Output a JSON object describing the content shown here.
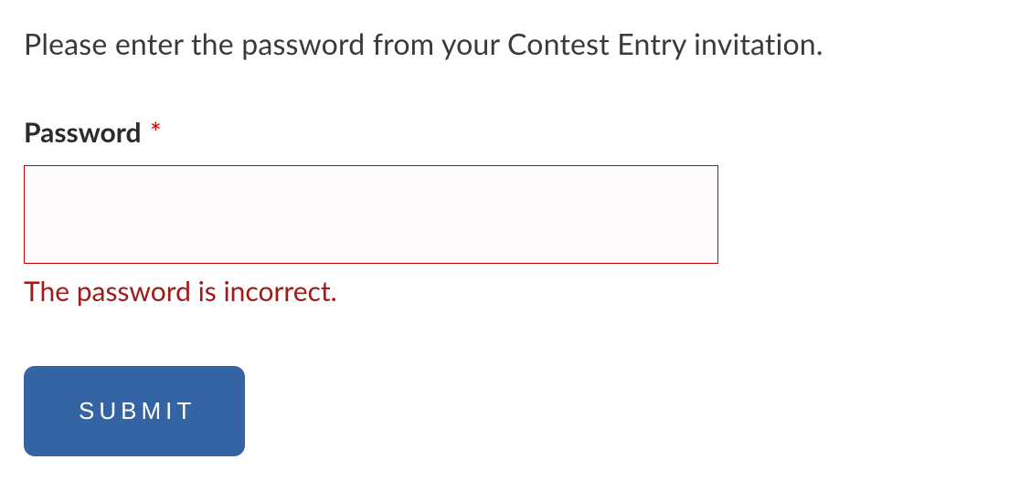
{
  "instruction": "Please enter the password from your Contest Entry invitation.",
  "field": {
    "label": "Password",
    "required_marker": "*",
    "value": "",
    "error": "The password is incorrect."
  },
  "submit_label": "SUBMIT",
  "colors": {
    "error_border": "#c70000",
    "error_text": "#a01a1a",
    "button_bg": "#3464a3"
  }
}
